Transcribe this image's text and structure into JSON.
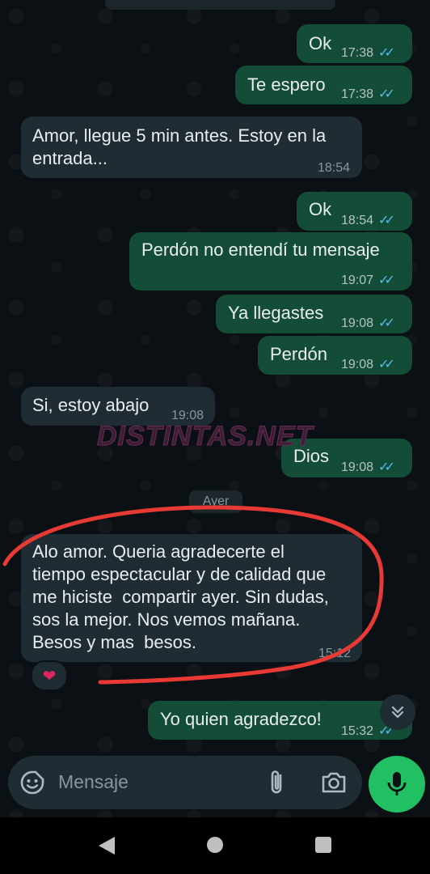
{
  "messages": [
    {
      "dir": "out",
      "text": "Ok",
      "time": "17:38",
      "read": true
    },
    {
      "dir": "out",
      "text": "Te espero",
      "time": "17:38",
      "read": true
    },
    {
      "dir": "in",
      "text": "Amor, llegue 5 min antes. Estoy en la\nentrada...",
      "time": "18:54"
    },
    {
      "dir": "out",
      "text": "Ok",
      "time": "18:54",
      "read": true
    },
    {
      "dir": "out",
      "text": "Perdón no entendí tu mensaje",
      "time": "19:07",
      "read": true
    },
    {
      "dir": "out",
      "text": "Ya llegastes",
      "time": "19:08",
      "read": true
    },
    {
      "dir": "out",
      "text": "Perdón",
      "time": "19:08",
      "read": true
    },
    {
      "dir": "in",
      "text": "Si, estoy abajo",
      "time": "19:08"
    },
    {
      "dir": "out",
      "text": "Dios",
      "time": "19:08",
      "read": true
    },
    {
      "dir": "in",
      "text": "Alo amor. Queria agradecerte el\ntiempo espectacular y de calidad que\nme hiciste  compartir ayer. Sin dudas,\nsos la mejor. Nos vemos mañana.\nBesos y mas  besos.",
      "time": "15:12",
      "reaction": "❤"
    },
    {
      "dir": "out",
      "text": "Yo quien agradezco!",
      "time": "15:32",
      "read": true
    }
  ],
  "day_separator": "Ayer",
  "watermark": "DISTINTAS.NET",
  "composer": {
    "placeholder": "Mensaje"
  },
  "icons": {
    "emoji": "sticker-emoji-icon",
    "attach": "paperclip-icon",
    "camera": "camera-icon",
    "mic": "microphone-icon",
    "scroll": "double-chevron-down-icon",
    "read_ticks": "double-check-icon"
  },
  "colors": {
    "background": "#0b1014",
    "outgoing": "#144d37",
    "incoming": "#1f2c34",
    "ticks": "#53bdeb",
    "mic_button": "#21c063",
    "annotation": "#e83a35"
  }
}
